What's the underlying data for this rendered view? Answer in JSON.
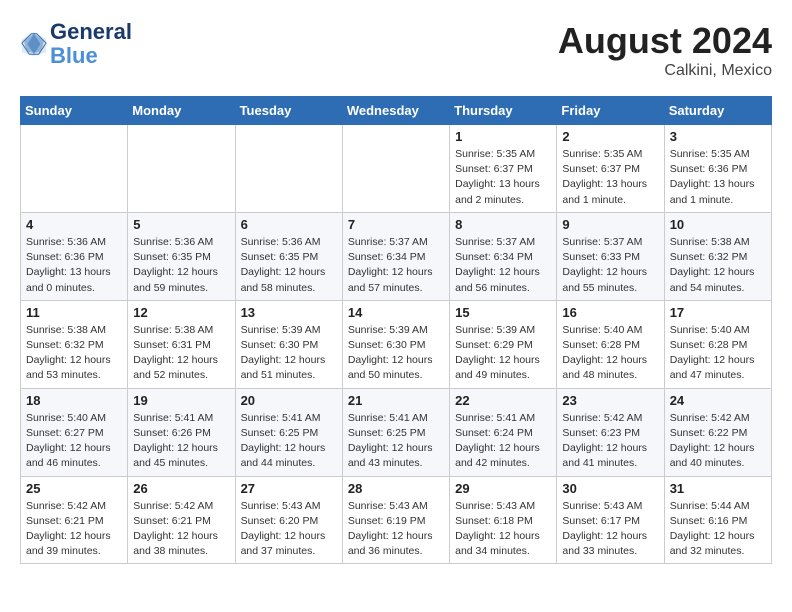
{
  "header": {
    "logo_line1": "General",
    "logo_line2": "Blue",
    "month_year": "August 2024",
    "location": "Calkini, Mexico"
  },
  "days_of_week": [
    "Sunday",
    "Monday",
    "Tuesday",
    "Wednesday",
    "Thursday",
    "Friday",
    "Saturday"
  ],
  "weeks": [
    [
      {
        "day": "",
        "info": ""
      },
      {
        "day": "",
        "info": ""
      },
      {
        "day": "",
        "info": ""
      },
      {
        "day": "",
        "info": ""
      },
      {
        "day": "1",
        "info": "Sunrise: 5:35 AM\nSunset: 6:37 PM\nDaylight: 13 hours\nand 2 minutes."
      },
      {
        "day": "2",
        "info": "Sunrise: 5:35 AM\nSunset: 6:37 PM\nDaylight: 13 hours\nand 1 minute."
      },
      {
        "day": "3",
        "info": "Sunrise: 5:35 AM\nSunset: 6:36 PM\nDaylight: 13 hours\nand 1 minute."
      }
    ],
    [
      {
        "day": "4",
        "info": "Sunrise: 5:36 AM\nSunset: 6:36 PM\nDaylight: 13 hours\nand 0 minutes."
      },
      {
        "day": "5",
        "info": "Sunrise: 5:36 AM\nSunset: 6:35 PM\nDaylight: 12 hours\nand 59 minutes."
      },
      {
        "day": "6",
        "info": "Sunrise: 5:36 AM\nSunset: 6:35 PM\nDaylight: 12 hours\nand 58 minutes."
      },
      {
        "day": "7",
        "info": "Sunrise: 5:37 AM\nSunset: 6:34 PM\nDaylight: 12 hours\nand 57 minutes."
      },
      {
        "day": "8",
        "info": "Sunrise: 5:37 AM\nSunset: 6:34 PM\nDaylight: 12 hours\nand 56 minutes."
      },
      {
        "day": "9",
        "info": "Sunrise: 5:37 AM\nSunset: 6:33 PM\nDaylight: 12 hours\nand 55 minutes."
      },
      {
        "day": "10",
        "info": "Sunrise: 5:38 AM\nSunset: 6:32 PM\nDaylight: 12 hours\nand 54 minutes."
      }
    ],
    [
      {
        "day": "11",
        "info": "Sunrise: 5:38 AM\nSunset: 6:32 PM\nDaylight: 12 hours\nand 53 minutes."
      },
      {
        "day": "12",
        "info": "Sunrise: 5:38 AM\nSunset: 6:31 PM\nDaylight: 12 hours\nand 52 minutes."
      },
      {
        "day": "13",
        "info": "Sunrise: 5:39 AM\nSunset: 6:30 PM\nDaylight: 12 hours\nand 51 minutes."
      },
      {
        "day": "14",
        "info": "Sunrise: 5:39 AM\nSunset: 6:30 PM\nDaylight: 12 hours\nand 50 minutes."
      },
      {
        "day": "15",
        "info": "Sunrise: 5:39 AM\nSunset: 6:29 PM\nDaylight: 12 hours\nand 49 minutes."
      },
      {
        "day": "16",
        "info": "Sunrise: 5:40 AM\nSunset: 6:28 PM\nDaylight: 12 hours\nand 48 minutes."
      },
      {
        "day": "17",
        "info": "Sunrise: 5:40 AM\nSunset: 6:28 PM\nDaylight: 12 hours\nand 47 minutes."
      }
    ],
    [
      {
        "day": "18",
        "info": "Sunrise: 5:40 AM\nSunset: 6:27 PM\nDaylight: 12 hours\nand 46 minutes."
      },
      {
        "day": "19",
        "info": "Sunrise: 5:41 AM\nSunset: 6:26 PM\nDaylight: 12 hours\nand 45 minutes."
      },
      {
        "day": "20",
        "info": "Sunrise: 5:41 AM\nSunset: 6:25 PM\nDaylight: 12 hours\nand 44 minutes."
      },
      {
        "day": "21",
        "info": "Sunrise: 5:41 AM\nSunset: 6:25 PM\nDaylight: 12 hours\nand 43 minutes."
      },
      {
        "day": "22",
        "info": "Sunrise: 5:41 AM\nSunset: 6:24 PM\nDaylight: 12 hours\nand 42 minutes."
      },
      {
        "day": "23",
        "info": "Sunrise: 5:42 AM\nSunset: 6:23 PM\nDaylight: 12 hours\nand 41 minutes."
      },
      {
        "day": "24",
        "info": "Sunrise: 5:42 AM\nSunset: 6:22 PM\nDaylight: 12 hours\nand 40 minutes."
      }
    ],
    [
      {
        "day": "25",
        "info": "Sunrise: 5:42 AM\nSunset: 6:21 PM\nDaylight: 12 hours\nand 39 minutes."
      },
      {
        "day": "26",
        "info": "Sunrise: 5:42 AM\nSunset: 6:21 PM\nDaylight: 12 hours\nand 38 minutes."
      },
      {
        "day": "27",
        "info": "Sunrise: 5:43 AM\nSunset: 6:20 PM\nDaylight: 12 hours\nand 37 minutes."
      },
      {
        "day": "28",
        "info": "Sunrise: 5:43 AM\nSunset: 6:19 PM\nDaylight: 12 hours\nand 36 minutes."
      },
      {
        "day": "29",
        "info": "Sunrise: 5:43 AM\nSunset: 6:18 PM\nDaylight: 12 hours\nand 34 minutes."
      },
      {
        "day": "30",
        "info": "Sunrise: 5:43 AM\nSunset: 6:17 PM\nDaylight: 12 hours\nand 33 minutes."
      },
      {
        "day": "31",
        "info": "Sunrise: 5:44 AM\nSunset: 6:16 PM\nDaylight: 12 hours\nand 32 minutes."
      }
    ]
  ]
}
